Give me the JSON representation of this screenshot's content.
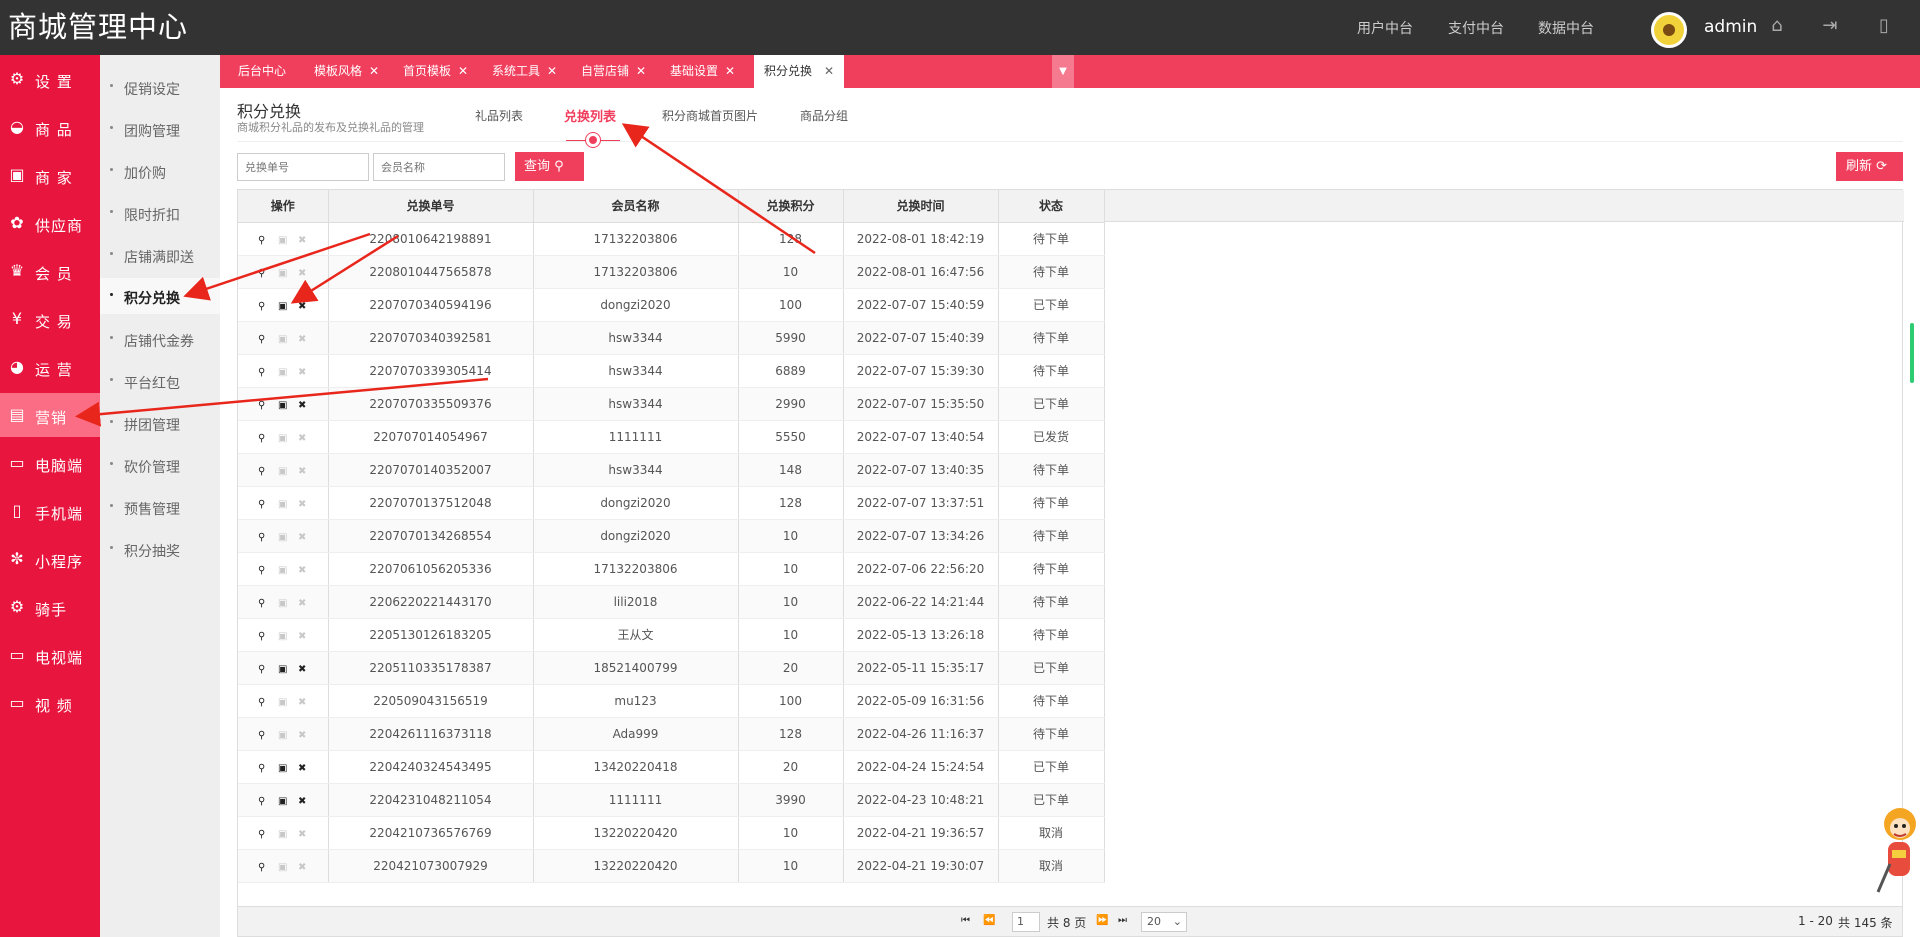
{
  "header": {
    "logo": "商城管理中心",
    "nav": [
      "用户中台",
      "支付中台",
      "数据中台"
    ],
    "username": "admin",
    "icons": [
      "home-icon",
      "logout-icon",
      "phone-icon"
    ]
  },
  "left_nav": [
    {
      "label": "设 置",
      "icon": "gear-icon"
    },
    {
      "label": "商 品",
      "icon": "basket-icon"
    },
    {
      "label": "商 家",
      "icon": "store-icon"
    },
    {
      "label": "供应商",
      "icon": "badge-icon"
    },
    {
      "label": "会 员",
      "icon": "crown-icon"
    },
    {
      "label": "交 易",
      "icon": "yen-icon"
    },
    {
      "label": "运 营",
      "icon": "pie-icon"
    },
    {
      "label": "营销",
      "icon": "marketing-icon",
      "active": true
    },
    {
      "label": "电脑端",
      "icon": "monitor-icon"
    },
    {
      "label": "手机端",
      "icon": "mobile-icon"
    },
    {
      "label": "小程序",
      "icon": "miniprogram-icon"
    },
    {
      "label": "骑手",
      "icon": "gear-icon"
    },
    {
      "label": "电视端",
      "icon": "tv-icon"
    },
    {
      "label": "视 频",
      "icon": "video-icon"
    }
  ],
  "sub_nav": [
    {
      "label": "促销设定"
    },
    {
      "label": "团购管理"
    },
    {
      "label": "加价购"
    },
    {
      "label": "限时折扣"
    },
    {
      "label": "店铺满即送"
    },
    {
      "label": "积分兑换",
      "active": true
    },
    {
      "label": "店铺代金券"
    },
    {
      "label": "平台红包"
    },
    {
      "label": "拼团管理"
    },
    {
      "label": "砍价管理"
    },
    {
      "label": "预售管理"
    },
    {
      "label": "积分抽奖"
    }
  ],
  "tabs": [
    {
      "label": "后台中心",
      "closable": false
    },
    {
      "label": "模板风格",
      "closable": true
    },
    {
      "label": "首页模板",
      "closable": true
    },
    {
      "label": "系统工具",
      "closable": true
    },
    {
      "label": "自营店铺",
      "closable": true
    },
    {
      "label": "基础设置",
      "closable": true
    },
    {
      "label": "积分兑换",
      "closable": true,
      "active": true
    }
  ],
  "page": {
    "title": "积分兑换",
    "subtitle": "商城积分礼品的发布及兑换礼品的管理",
    "subtabs": [
      "礼品列表",
      "兑换列表",
      "积分商城首页图片",
      "商品分组"
    ],
    "active_subtab": "兑换列表"
  },
  "filters": {
    "order_placeholder": "兑换单号",
    "member_placeholder": "会员名称",
    "query_label": "查询",
    "refresh_label": "刷新"
  },
  "table": {
    "columns": [
      "操作",
      "兑换单号",
      "会员名称",
      "兑换积分",
      "兑换时间",
      "状态"
    ],
    "rows": [
      {
        "order": "2208010642198891",
        "member": "17132203806",
        "points": "128",
        "time": "2022-08-01 18:42:19",
        "status": "待下单",
        "ops_enabled": false
      },
      {
        "order": "2208010447565878",
        "member": "17132203806",
        "points": "10",
        "time": "2022-08-01 16:47:56",
        "status": "待下单",
        "ops_enabled": false
      },
      {
        "order": "2207070340594196",
        "member": "dongzi2020",
        "points": "100",
        "time": "2022-07-07 15:40:59",
        "status": "已下单",
        "ops_enabled": true
      },
      {
        "order": "2207070340392581",
        "member": "hsw3344",
        "points": "5990",
        "time": "2022-07-07 15:40:39",
        "status": "待下单",
        "ops_enabled": false
      },
      {
        "order": "2207070339305414",
        "member": "hsw3344",
        "points": "6889",
        "time": "2022-07-07 15:39:30",
        "status": "待下单",
        "ops_enabled": false
      },
      {
        "order": "2207070335509376",
        "member": "hsw3344",
        "points": "2990",
        "time": "2022-07-07 15:35:50",
        "status": "已下单",
        "ops_enabled": true
      },
      {
        "order": "220707014054967",
        "member": "1111111",
        "points": "5550",
        "time": "2022-07-07 13:40:54",
        "status": "已发货",
        "ops_enabled": false
      },
      {
        "order": "2207070140352007",
        "member": "hsw3344",
        "points": "148",
        "time": "2022-07-07 13:40:35",
        "status": "待下单",
        "ops_enabled": false
      },
      {
        "order": "2207070137512048",
        "member": "dongzi2020",
        "points": "128",
        "time": "2022-07-07 13:37:51",
        "status": "待下单",
        "ops_enabled": false
      },
      {
        "order": "2207070134268554",
        "member": "dongzi2020",
        "points": "10",
        "time": "2022-07-07 13:34:26",
        "status": "待下单",
        "ops_enabled": false
      },
      {
        "order": "2207061056205336",
        "member": "17132203806",
        "points": "10",
        "time": "2022-07-06 22:56:20",
        "status": "待下单",
        "ops_enabled": false
      },
      {
        "order": "2206220221443170",
        "member": "lili2018",
        "points": "10",
        "time": "2022-06-22 14:21:44",
        "status": "待下单",
        "ops_enabled": false
      },
      {
        "order": "2205130126183205",
        "member": "王从文",
        "points": "10",
        "time": "2022-05-13 13:26:18",
        "status": "待下单",
        "ops_enabled": false
      },
      {
        "order": "2205110335178387",
        "member": "18521400799",
        "points": "20",
        "time": "2022-05-11 15:35:17",
        "status": "已下单",
        "ops_enabled": true
      },
      {
        "order": "220509043156519",
        "member": "mu123",
        "points": "100",
        "time": "2022-05-09 16:31:56",
        "status": "待下单",
        "ops_enabled": false
      },
      {
        "order": "2204261116373118",
        "member": "Ada999",
        "points": "128",
        "time": "2022-04-26 11:16:37",
        "status": "待下单",
        "ops_enabled": false
      },
      {
        "order": "2204240324543495",
        "member": "13420220418",
        "points": "20",
        "time": "2022-04-24 15:24:54",
        "status": "已下单",
        "ops_enabled": true
      },
      {
        "order": "2204231048211054",
        "member": "1111111",
        "points": "3990",
        "time": "2022-04-23 10:48:21",
        "status": "已下单",
        "ops_enabled": true
      },
      {
        "order": "2204210736576769",
        "member": "13220220420",
        "points": "10",
        "time": "2022-04-21 19:36:57",
        "status": "取消",
        "ops_enabled": false
      },
      {
        "order": "220421073007929",
        "member": "13220220420",
        "points": "10",
        "time": "2022-04-21 19:30:07",
        "status": "取消",
        "ops_enabled": false
      }
    ]
  },
  "pager": {
    "current_page": "1",
    "total_pages_text": "共 8 页",
    "page_size": "20",
    "range_text": "1 - 20",
    "total_text": "共 145 条"
  },
  "colors": {
    "accent": "#f03e5d",
    "sidebar": "#e8163f",
    "header": "#333333",
    "annotation_arrow": "#e8261c"
  }
}
